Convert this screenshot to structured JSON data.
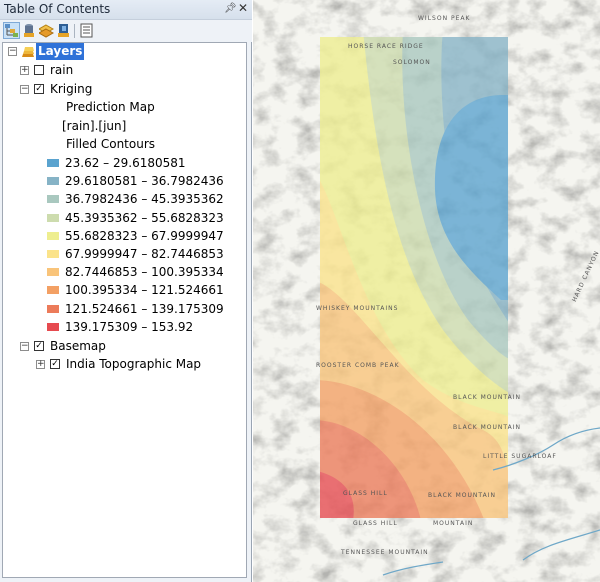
{
  "toc": {
    "title": "Table Of Contents",
    "pin_icon": "pin-icon",
    "close_icon": "close-icon",
    "toolbar": [
      {
        "name": "list-by-drawing-order",
        "icon": "list-drawing-order-icon",
        "active": true
      },
      {
        "name": "list-by-source",
        "icon": "list-by-source-icon",
        "active": false
      },
      {
        "name": "list-by-visibility",
        "icon": "list-by-visibility-icon",
        "active": false
      },
      {
        "name": "list-by-selection",
        "icon": "list-by-selection-icon",
        "active": false
      },
      {
        "name": "options",
        "icon": "options-icon",
        "active": false
      }
    ],
    "root": {
      "label": "Layers",
      "expanded": true,
      "selected": true
    },
    "layers": [
      {
        "label": "rain",
        "checked": false,
        "expanded": false
      },
      {
        "label": "Kriging",
        "checked": true,
        "expanded": true,
        "legend_heading": "Prediction Map",
        "field": "[rain].[jun]",
        "symbology": "Filled Contours",
        "classes": [
          {
            "label": "23.62 – 29.6180581",
            "color": "#5aa3cf"
          },
          {
            "label": "29.6180581 – 36.7982436",
            "color": "#86b3c6"
          },
          {
            "label": "36.7982436 – 45.3935362",
            "color": "#a9c8bf"
          },
          {
            "label": "45.3935362 – 55.6828323",
            "color": "#cddcae"
          },
          {
            "label": "55.6828323 – 67.9999947",
            "color": "#eeee8f"
          },
          {
            "label": "67.9999947 – 82.7446853",
            "color": "#fbe38a"
          },
          {
            "label": "82.7446853 – 100.395334",
            "color": "#f9c47a"
          },
          {
            "label": "100.395334 – 121.524661",
            "color": "#f3a064"
          },
          {
            "label": "121.524661 – 139.175309",
            "color": "#ec7b5a"
          },
          {
            "label": "139.175309 – 153.92",
            "color": "#e64a4f"
          }
        ]
      },
      {
        "label": "Basemap",
        "checked": true,
        "expanded": true,
        "children": [
          {
            "label": "India Topographic Map",
            "checked": true,
            "expanded": false
          }
        ]
      }
    ]
  },
  "map": {
    "labels": [
      {
        "text": "WILSON PEAK"
      },
      {
        "text": "HORSE RACE RIDGE"
      },
      {
        "text": "SOLOMON"
      },
      {
        "text": "WHISKEY MOUNTAINS"
      },
      {
        "text": "ROOSTER COMB PEAK"
      },
      {
        "text": "BLACK MOUNTAIN"
      },
      {
        "text": "BLACK MOUNTAIN"
      },
      {
        "text": "LITTLE SUGARLOAF"
      },
      {
        "text": "GLASS HILL"
      },
      {
        "text": "GLASS HILL"
      },
      {
        "text": "BLACK MOUNTAIN"
      },
      {
        "text": "MOUNTAIN"
      },
      {
        "text": "TENNESSEE MOUNTAIN"
      },
      {
        "text": "HARD CANYON"
      }
    ]
  }
}
